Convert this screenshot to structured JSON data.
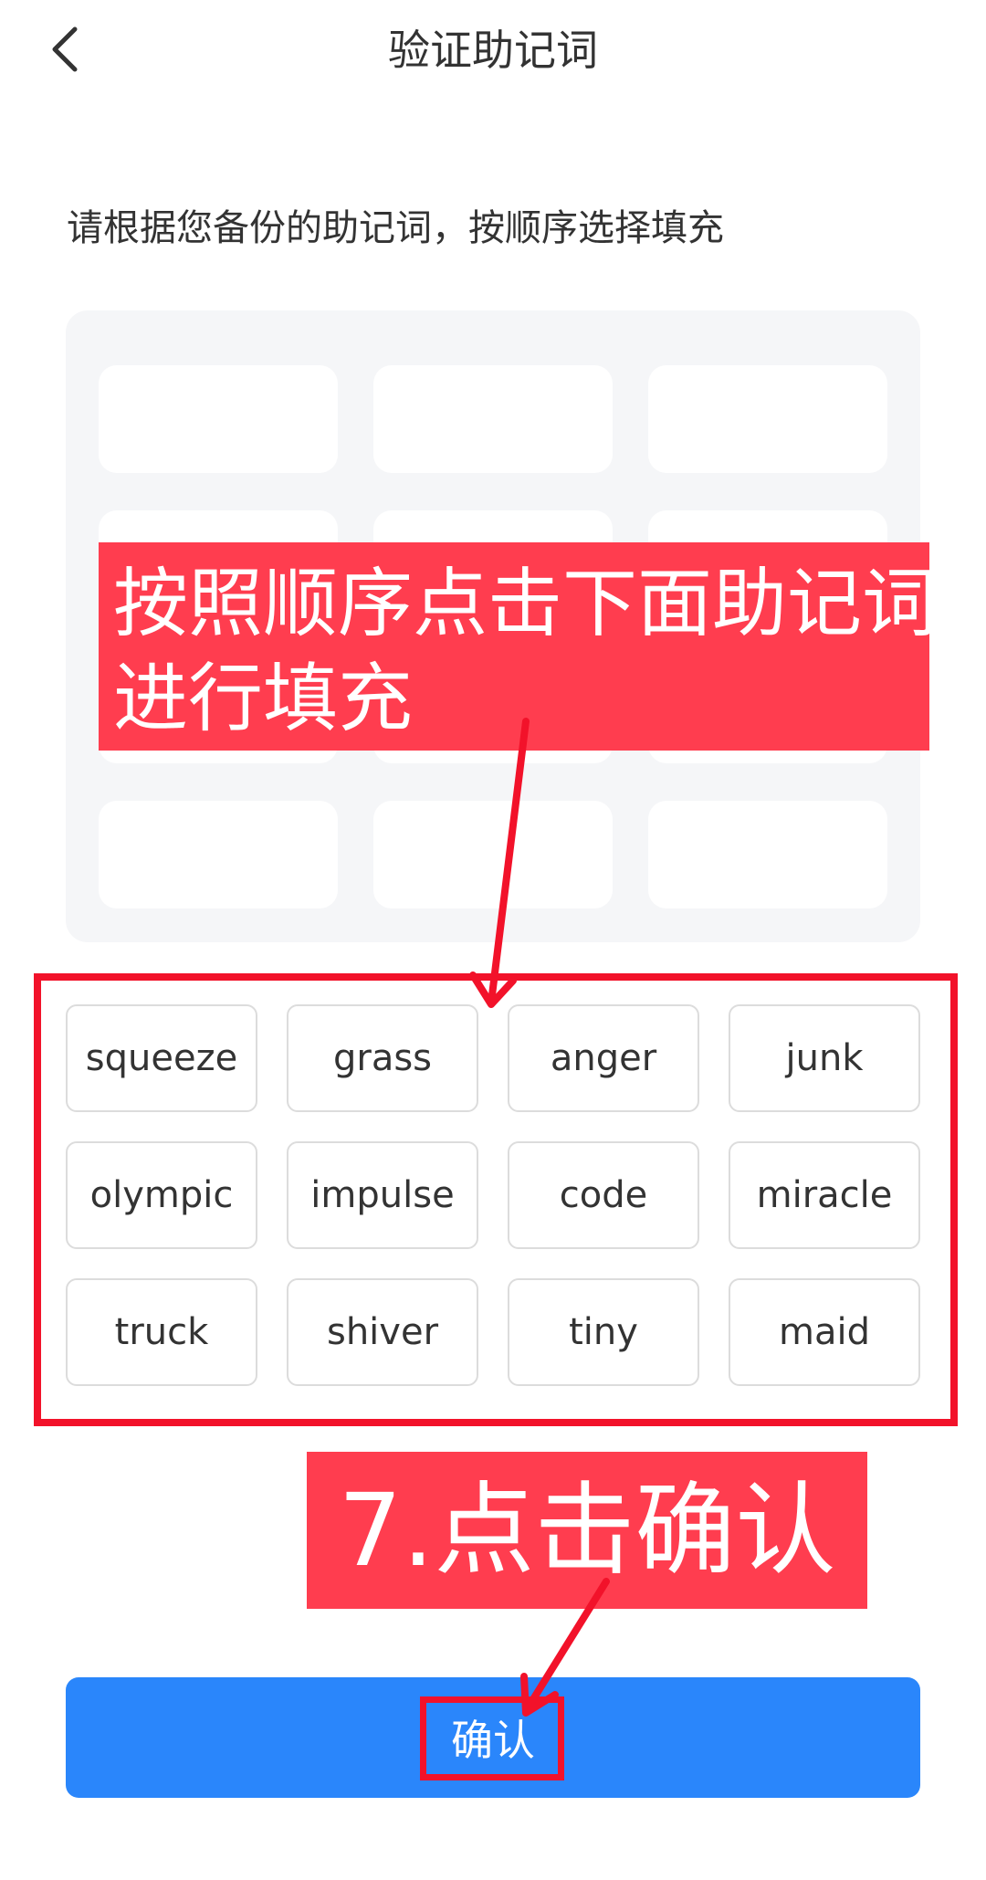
{
  "header": {
    "title": "验证助记词",
    "back_icon": "chevron-left-icon"
  },
  "instruction": "请根据您备份的助记词，按顺序选择填充",
  "slots_count": 12,
  "words": [
    "squeeze",
    "grass",
    "anger",
    "junk",
    "olympic",
    "impulse",
    "code",
    "miracle",
    "truck",
    "shiver",
    "tiny",
    "maid"
  ],
  "confirm_label": "确认",
  "annotations": {
    "callout_top_line1": "按照顺序点击下面助记词",
    "callout_top_line2": "进行填充",
    "callout_bottom": "7.点击确认"
  },
  "colors": {
    "primary": "#2a86fb",
    "annotation_fill": "#ff3d4f",
    "annotation_stroke": "#f2122a",
    "panel": "#f5f6f8"
  }
}
